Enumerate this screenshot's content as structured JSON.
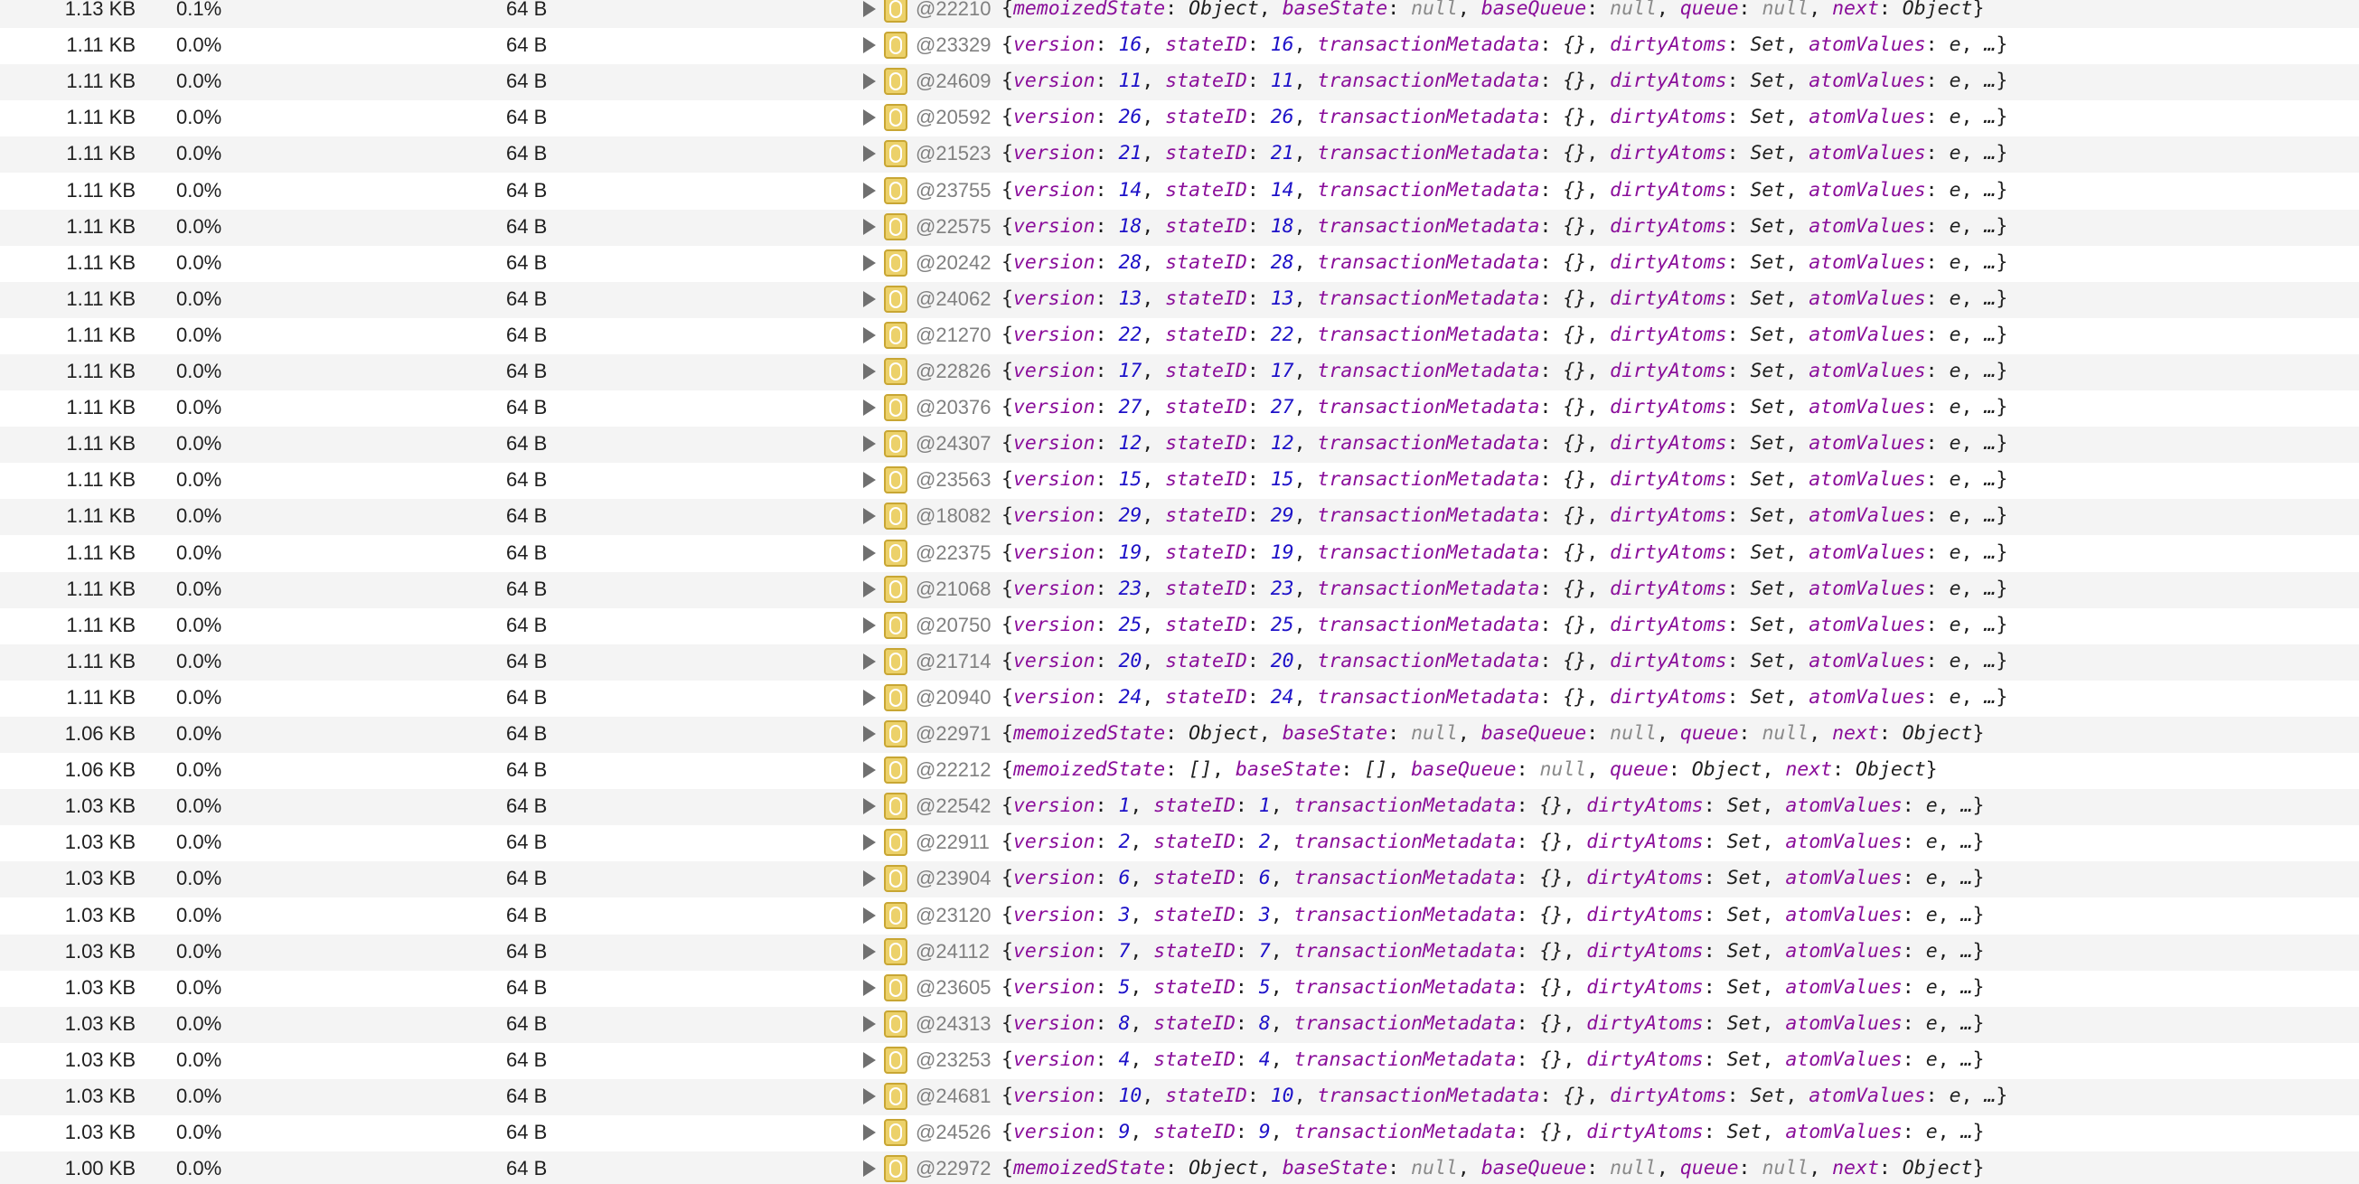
{
  "rows": [
    {
      "retained": "1.13 KB",
      "percent": "0.1%",
      "shallow": "64 B",
      "id": "@22210",
      "kind": "hook",
      "fields": [
        [
          "memoizedState",
          "Object"
        ],
        [
          "baseState",
          "null"
        ],
        [
          "baseQueue",
          "null"
        ],
        [
          "queue",
          "null"
        ],
        [
          "next",
          "Object"
        ]
      ]
    },
    {
      "retained": "1.11 KB",
      "percent": "0.0%",
      "shallow": "64 B",
      "id": "@23329",
      "kind": "snapshot",
      "version": "16",
      "stateID": "16"
    },
    {
      "retained": "1.11 KB",
      "percent": "0.0%",
      "shallow": "64 B",
      "id": "@24609",
      "kind": "snapshot",
      "version": "11",
      "stateID": "11"
    },
    {
      "retained": "1.11 KB",
      "percent": "0.0%",
      "shallow": "64 B",
      "id": "@20592",
      "kind": "snapshot",
      "version": "26",
      "stateID": "26"
    },
    {
      "retained": "1.11 KB",
      "percent": "0.0%",
      "shallow": "64 B",
      "id": "@21523",
      "kind": "snapshot",
      "version": "21",
      "stateID": "21"
    },
    {
      "retained": "1.11 KB",
      "percent": "0.0%",
      "shallow": "64 B",
      "id": "@23755",
      "kind": "snapshot",
      "version": "14",
      "stateID": "14"
    },
    {
      "retained": "1.11 KB",
      "percent": "0.0%",
      "shallow": "64 B",
      "id": "@22575",
      "kind": "snapshot",
      "version": "18",
      "stateID": "18"
    },
    {
      "retained": "1.11 KB",
      "percent": "0.0%",
      "shallow": "64 B",
      "id": "@20242",
      "kind": "snapshot",
      "version": "28",
      "stateID": "28"
    },
    {
      "retained": "1.11 KB",
      "percent": "0.0%",
      "shallow": "64 B",
      "id": "@24062",
      "kind": "snapshot",
      "version": "13",
      "stateID": "13"
    },
    {
      "retained": "1.11 KB",
      "percent": "0.0%",
      "shallow": "64 B",
      "id": "@21270",
      "kind": "snapshot",
      "version": "22",
      "stateID": "22"
    },
    {
      "retained": "1.11 KB",
      "percent": "0.0%",
      "shallow": "64 B",
      "id": "@22826",
      "kind": "snapshot",
      "version": "17",
      "stateID": "17"
    },
    {
      "retained": "1.11 KB",
      "percent": "0.0%",
      "shallow": "64 B",
      "id": "@20376",
      "kind": "snapshot",
      "version": "27",
      "stateID": "27"
    },
    {
      "retained": "1.11 KB",
      "percent": "0.0%",
      "shallow": "64 B",
      "id": "@24307",
      "kind": "snapshot",
      "version": "12",
      "stateID": "12"
    },
    {
      "retained": "1.11 KB",
      "percent": "0.0%",
      "shallow": "64 B",
      "id": "@23563",
      "kind": "snapshot",
      "version": "15",
      "stateID": "15"
    },
    {
      "retained": "1.11 KB",
      "percent": "0.0%",
      "shallow": "64 B",
      "id": "@18082",
      "kind": "snapshot",
      "version": "29",
      "stateID": "29"
    },
    {
      "retained": "1.11 KB",
      "percent": "0.0%",
      "shallow": "64 B",
      "id": "@22375",
      "kind": "snapshot",
      "version": "19",
      "stateID": "19"
    },
    {
      "retained": "1.11 KB",
      "percent": "0.0%",
      "shallow": "64 B",
      "id": "@21068",
      "kind": "snapshot",
      "version": "23",
      "stateID": "23"
    },
    {
      "retained": "1.11 KB",
      "percent": "0.0%",
      "shallow": "64 B",
      "id": "@20750",
      "kind": "snapshot",
      "version": "25",
      "stateID": "25"
    },
    {
      "retained": "1.11 KB",
      "percent": "0.0%",
      "shallow": "64 B",
      "id": "@21714",
      "kind": "snapshot",
      "version": "20",
      "stateID": "20"
    },
    {
      "retained": "1.11 KB",
      "percent": "0.0%",
      "shallow": "64 B",
      "id": "@20940",
      "kind": "snapshot",
      "version": "24",
      "stateID": "24"
    },
    {
      "retained": "1.06 KB",
      "percent": "0.0%",
      "shallow": "64 B",
      "id": "@22971",
      "kind": "hook",
      "fields": [
        [
          "memoizedState",
          "Object"
        ],
        [
          "baseState",
          "null"
        ],
        [
          "baseQueue",
          "null"
        ],
        [
          "queue",
          "null"
        ],
        [
          "next",
          "Object"
        ]
      ]
    },
    {
      "retained": "1.06 KB",
      "percent": "0.0%",
      "shallow": "64 B",
      "id": "@22212",
      "kind": "hook",
      "fields": [
        [
          "memoizedState",
          "[]"
        ],
        [
          "baseState",
          "[]"
        ],
        [
          "baseQueue",
          "null"
        ],
        [
          "queue",
          "Object"
        ],
        [
          "next",
          "Object"
        ]
      ]
    },
    {
      "retained": "1.03 KB",
      "percent": "0.0%",
      "shallow": "64 B",
      "id": "@22542",
      "kind": "snapshot",
      "version": "1",
      "stateID": "1"
    },
    {
      "retained": "1.03 KB",
      "percent": "0.0%",
      "shallow": "64 B",
      "id": "@22911",
      "kind": "snapshot",
      "version": "2",
      "stateID": "2"
    },
    {
      "retained": "1.03 KB",
      "percent": "0.0%",
      "shallow": "64 B",
      "id": "@23904",
      "kind": "snapshot",
      "version": "6",
      "stateID": "6"
    },
    {
      "retained": "1.03 KB",
      "percent": "0.0%",
      "shallow": "64 B",
      "id": "@23120",
      "kind": "snapshot",
      "version": "3",
      "stateID": "3"
    },
    {
      "retained": "1.03 KB",
      "percent": "0.0%",
      "shallow": "64 B",
      "id": "@24112",
      "kind": "snapshot",
      "version": "7",
      "stateID": "7"
    },
    {
      "retained": "1.03 KB",
      "percent": "0.0%",
      "shallow": "64 B",
      "id": "@23605",
      "kind": "snapshot",
      "version": "5",
      "stateID": "5"
    },
    {
      "retained": "1.03 KB",
      "percent": "0.0%",
      "shallow": "64 B",
      "id": "@24313",
      "kind": "snapshot",
      "version": "8",
      "stateID": "8"
    },
    {
      "retained": "1.03 KB",
      "percent": "0.0%",
      "shallow": "64 B",
      "id": "@23253",
      "kind": "snapshot",
      "version": "4",
      "stateID": "4"
    },
    {
      "retained": "1.03 KB",
      "percent": "0.0%",
      "shallow": "64 B",
      "id": "@24681",
      "kind": "snapshot",
      "version": "10",
      "stateID": "10"
    },
    {
      "retained": "1.03 KB",
      "percent": "0.0%",
      "shallow": "64 B",
      "id": "@24526",
      "kind": "snapshot",
      "version": "9",
      "stateID": "9"
    },
    {
      "retained": "1.00 KB",
      "percent": "0.0%",
      "shallow": "64 B",
      "id": "@22972",
      "kind": "hook",
      "fields": [
        [
          "memoizedState",
          "Object"
        ],
        [
          "baseState",
          "null"
        ],
        [
          "baseQueue",
          "null"
        ],
        [
          "queue",
          "null"
        ],
        [
          "next",
          "Object"
        ]
      ]
    }
  ],
  "snapshot_fields": {
    "txn_key": "transactionMetadata",
    "txn_value": "{}",
    "dirty_key": "dirtyAtoms",
    "dirty_value": "Set",
    "atom_key": "atomValues",
    "atom_value": "e",
    "ellipsis": "…"
  },
  "icons": {
    "expand": "disclosure-triangle-icon",
    "object": "object-type-icon"
  },
  "colors": {
    "key": "#8a0e9a",
    "number": "#1c10c8",
    "null": "#8a8a8a",
    "id": "#808080",
    "stripe": "#f4f4f4",
    "badge": "#ecd16a"
  }
}
